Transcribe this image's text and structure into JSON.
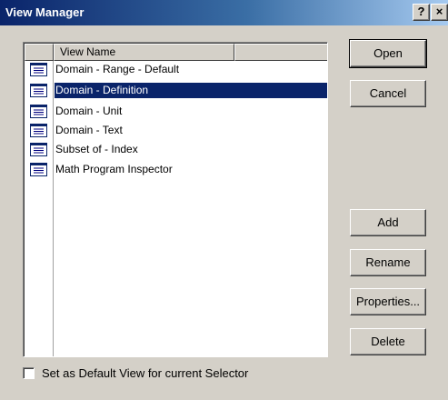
{
  "window": {
    "title": "View Manager",
    "help_label": "?",
    "close_label": "×"
  },
  "list": {
    "columns": [
      "",
      "View Name",
      ""
    ],
    "items": [
      {
        "label": "Domain - Range - Default",
        "icon": "list-view-icon",
        "selected": false
      },
      {
        "label": "Domain - Definition",
        "icon": "list-view-icon",
        "selected": true
      },
      {
        "label": "Domain - Unit",
        "icon": "list-view-icon",
        "selected": false
      },
      {
        "label": "Domain - Text",
        "icon": "list-view-icon",
        "selected": false
      },
      {
        "label": "Subset of - Index",
        "icon": "list-view-icon",
        "selected": false
      },
      {
        "label": "Math Program Inspector",
        "icon": "list-view-icon",
        "selected": false
      }
    ]
  },
  "buttons": {
    "open": "Open",
    "cancel": "Cancel",
    "add": "Add",
    "rename": "Rename",
    "properties": "Properties...",
    "delete": "Delete"
  },
  "default_view_checkbox": {
    "label": "Set as Default View for current Selector",
    "checked": false
  },
  "colors": {
    "selection": "#0a246a",
    "dialog_face": "#d4d0c8",
    "titlebar_start": "#0a246a",
    "titlebar_end": "#a6caf0"
  }
}
